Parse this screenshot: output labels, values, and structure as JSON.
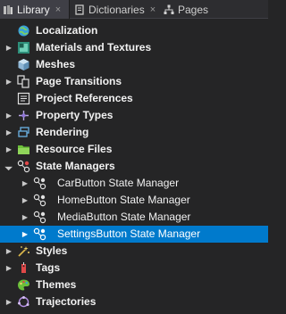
{
  "tabs": [
    {
      "label": "Library",
      "close": "×",
      "active": true
    },
    {
      "label": "Dictionaries",
      "close": "×",
      "active": false
    },
    {
      "label": "Pages",
      "active": false
    }
  ],
  "tree": {
    "items": [
      {
        "label": "Localization",
        "icon": "globe-icon",
        "expanded": null
      },
      {
        "label": "Materials and Textures",
        "icon": "materials-icon",
        "expanded": false
      },
      {
        "label": "Meshes",
        "icon": "mesh-cube-icon",
        "expanded": null
      },
      {
        "label": "Page Transitions",
        "icon": "page-transitions-icon",
        "expanded": false
      },
      {
        "label": "Project References",
        "icon": "project-references-icon",
        "expanded": null
      },
      {
        "label": "Property Types",
        "icon": "property-types-icon",
        "expanded": false
      },
      {
        "label": "Rendering",
        "icon": "rendering-icon",
        "expanded": false
      },
      {
        "label": "Resource Files",
        "icon": "folder-icon",
        "expanded": false
      },
      {
        "label": "State Managers",
        "icon": "state-managers-icon",
        "expanded": true
      },
      {
        "label": "CarButton State Manager",
        "icon": "state-manager-icon",
        "expanded": false
      },
      {
        "label": "HomeButton State Manager",
        "icon": "state-manager-icon",
        "expanded": false
      },
      {
        "label": "MediaButton State Manager",
        "icon": "state-manager-icon",
        "expanded": false
      },
      {
        "label": "SettingsButton State Manager",
        "icon": "state-manager-icon",
        "expanded": false,
        "selected": true
      },
      {
        "label": "Styles",
        "icon": "styles-icon",
        "expanded": false
      },
      {
        "label": "Tags",
        "icon": "tag-icon",
        "expanded": false
      },
      {
        "label": "Themes",
        "icon": "palette-icon",
        "expanded": null
      },
      {
        "label": "Trajectories",
        "icon": "trajectory-icon",
        "expanded": false
      }
    ]
  },
  "colors": {
    "background": "#252526",
    "selection": "#007acc",
    "tabbar": "#2d2d30"
  }
}
